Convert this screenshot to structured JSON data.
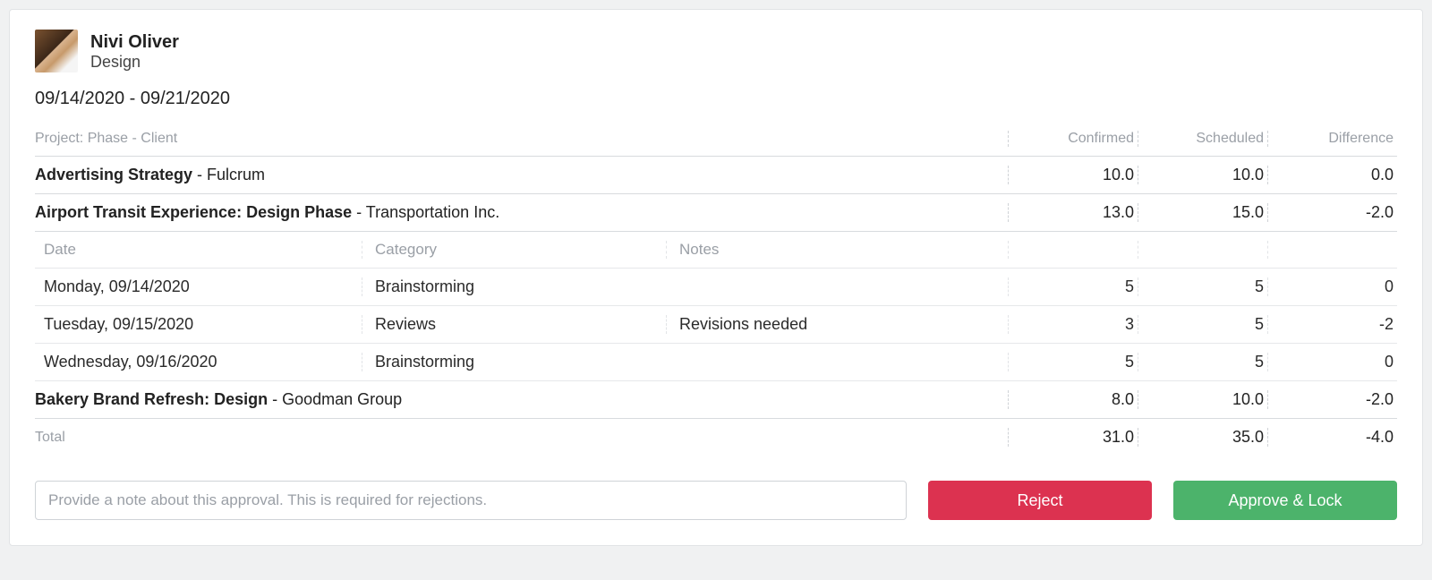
{
  "user": {
    "name": "Nivi Oliver",
    "role": "Design"
  },
  "date_range": "09/14/2020 - 09/21/2020",
  "columns": {
    "project_header": "Project: Phase - Client",
    "confirmed": "Confirmed",
    "scheduled": "Scheduled",
    "difference": "Difference",
    "date": "Date",
    "category": "Category",
    "notes": "Notes",
    "total": "Total"
  },
  "projects": [
    {
      "name": "Advertising Strategy",
      "client": "Fulcrum",
      "confirmed": "10.0",
      "scheduled": "10.0",
      "difference": "0.0",
      "entries": []
    },
    {
      "name": "Airport Transit Experience: Design Phase",
      "client": "Transportation Inc.",
      "confirmed": "13.0",
      "scheduled": "15.0",
      "difference": "-2.0",
      "entries": [
        {
          "date": "Monday, 09/14/2020",
          "category": "Brainstorming",
          "notes": "",
          "confirmed": "5",
          "scheduled": "5",
          "difference": "0"
        },
        {
          "date": "Tuesday, 09/15/2020",
          "category": "Reviews",
          "notes": "Revisions needed",
          "confirmed": "3",
          "scheduled": "5",
          "difference": "-2"
        },
        {
          "date": "Wednesday, 09/16/2020",
          "category": "Brainstorming",
          "notes": "",
          "confirmed": "5",
          "scheduled": "5",
          "difference": "0"
        }
      ]
    },
    {
      "name": "Bakery Brand Refresh: Design",
      "client": "Goodman Group",
      "confirmed": "8.0",
      "scheduled": "10.0",
      "difference": "-2.0",
      "entries": []
    }
  ],
  "totals": {
    "confirmed": "31.0",
    "scheduled": "35.0",
    "difference": "-4.0"
  },
  "actions": {
    "note_placeholder": "Provide a note about this approval. This is required for rejections.",
    "reject": "Reject",
    "approve": "Approve & Lock"
  }
}
